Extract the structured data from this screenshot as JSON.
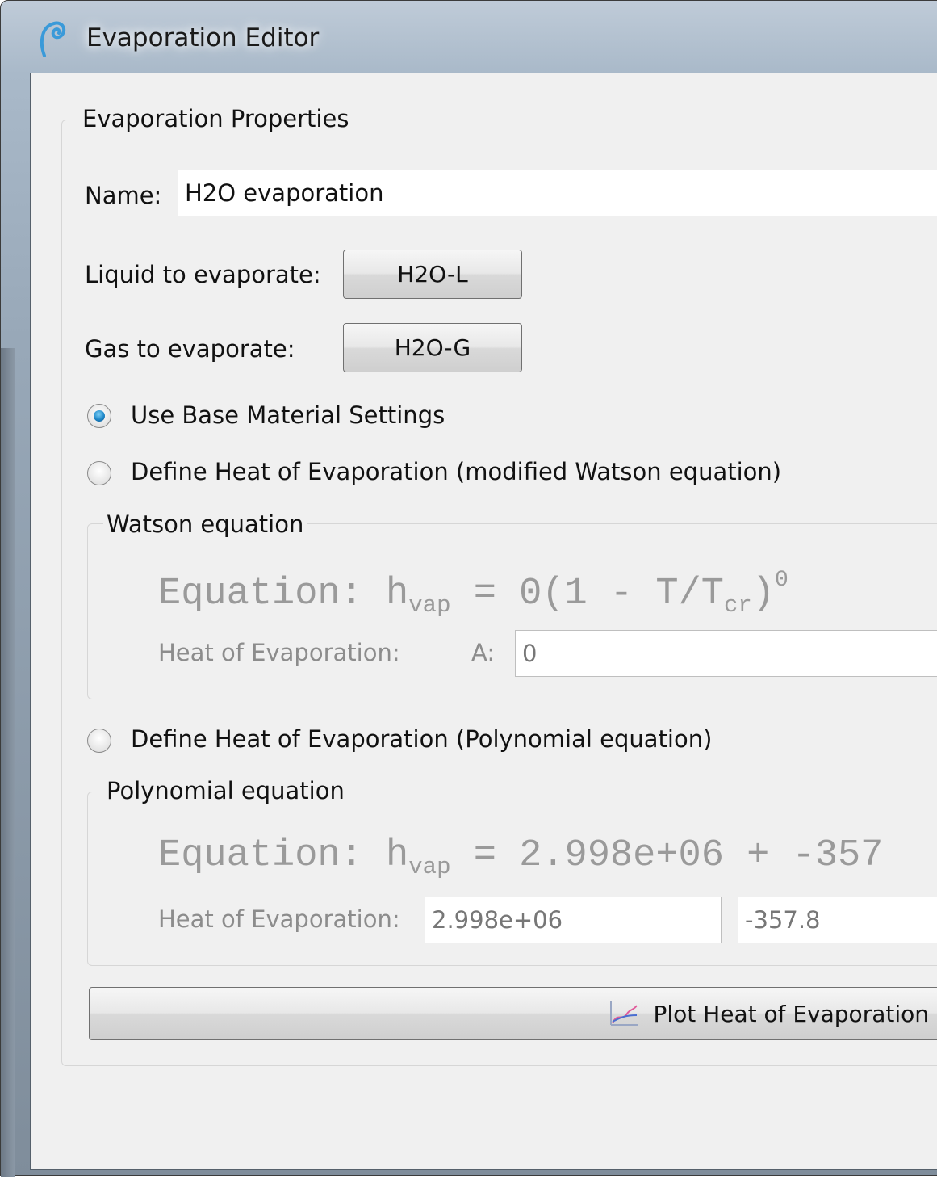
{
  "window": {
    "title": "Evaporation Editor",
    "icon": "app-swirl-icon"
  },
  "properties": {
    "group_title": "Evaporation Properties",
    "name_label": "Name:",
    "name_value": "H2O evaporation",
    "liquid_label": "Liquid to evaporate:",
    "liquid_button": "H2O-L",
    "gas_label": "Gas to evaporate:",
    "gas_button": "H2O-G"
  },
  "options": {
    "base": "Use Base Material Settings",
    "watson": "Define Heat of Evaporation (modified Watson equation)",
    "polynomial": "Define Heat of Evaporation (Polynomial equation)",
    "selected": "base"
  },
  "watson": {
    "group_title": "Watson equation",
    "eq_prefix": "Equation: h",
    "eq_sub": "vap",
    "eq_mid": " = 0(1 - T/T",
    "eq_sub2": "cr",
    "eq_close": ")",
    "eq_exp": "0",
    "heat_label": "Heat of Evaporation:",
    "a_label": "A:",
    "a_value": "0"
  },
  "polynomial": {
    "group_title": "Polynomial equation",
    "eq_prefix": "Equation: h",
    "eq_sub": "vap",
    "eq_rest": " = 2.998e+06 + -357",
    "heat_label": "Heat of Evaporation:",
    "c0_value": "2.998e+06",
    "c1_value": "-357.8"
  },
  "plot_button": {
    "label": "Plot Heat of Evaporation",
    "icon": "chart-line-icon"
  },
  "colors": {
    "radio_selected": "#1e88c9",
    "disabled_text": "#8c8c8c"
  }
}
